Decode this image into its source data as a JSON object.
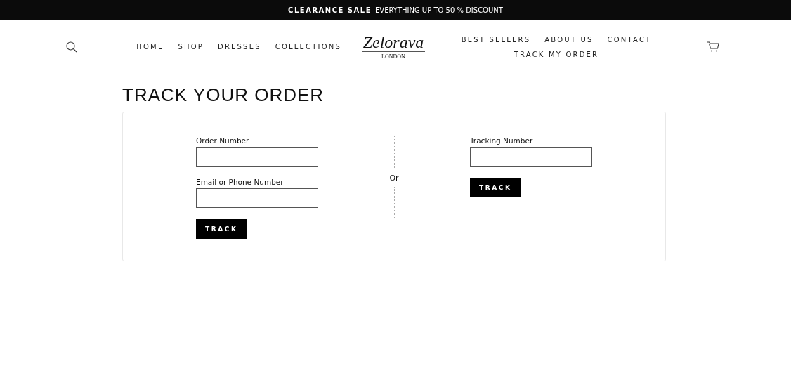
{
  "announcement": {
    "highlight": "CLEARANCE SALE",
    "text": "EVERYTHING UP TO 50 % DISCOUNT"
  },
  "nav_left": [
    "HOME",
    "SHOP",
    "DRESSES",
    "COLLECTIONS"
  ],
  "logo": {
    "name": "Zelorava",
    "tagline": "LONDON"
  },
  "nav_right": [
    "BEST SELLERS",
    "ABOUT US",
    "CONTACT",
    "TRACK MY ORDER"
  ],
  "page_title": "TRACK YOUR ORDER",
  "order_form": {
    "fields": [
      {
        "label": "Order Number"
      },
      {
        "label": "Email or Phone Number"
      }
    ],
    "button": "TRACK"
  },
  "separator": "Or",
  "tracking_form": {
    "fields": [
      {
        "label": "Tracking Number"
      }
    ],
    "button": "TRACK"
  }
}
